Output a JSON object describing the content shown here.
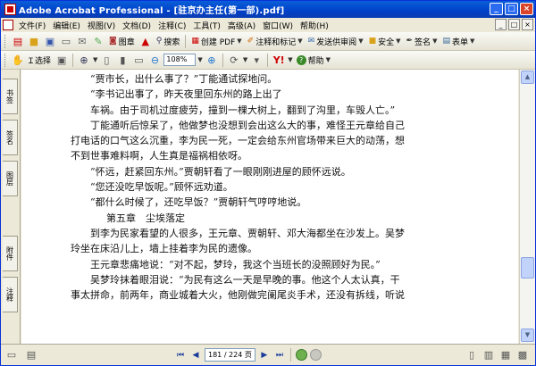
{
  "window": {
    "title": "Adobe Acrobat Professional - [驻京办主任(第一部).pdf]",
    "buttons": {
      "minimize": "_",
      "maximize": "□",
      "close": "×"
    }
  },
  "menu": {
    "items": [
      "文件(F)",
      "编辑(E)",
      "视图(V)",
      "文档(D)",
      "注释(C)",
      "工具(T)",
      "高级(A)",
      "窗口(W)",
      "帮助(H)"
    ]
  },
  "toolbar1": {
    "organizer": "图章",
    "search": "搜索",
    "create_pdf": "创建 PDF",
    "review": "注释和标记",
    "send": "发送供审阅",
    "secure": "安全",
    "sign": "签名",
    "forms": "表单"
  },
  "toolbar2": {
    "select": "选择",
    "zoom": "108%",
    "help": "帮助"
  },
  "side_tabs": [
    "书签",
    "签名",
    "图层",
    "附件",
    "注释"
  ],
  "document": {
    "lines": [
      "“贾市长，出什么事了？”丁能通试探地问。",
      "“李书记出事了，昨天夜里回东州的路上出了",
      "车祸。由于司机过度疲劳，撞到一棵大树上，翻到了沟里，车毁人亡。”",
      "丁能通听后惊呆了，他做梦也没想到会出这么大的事，难怪王元章给自己",
      "打电话的口气这么沉重，李为民一死，一定会给东州官场带来巨大的动荡，想",
      "不到世事难料啊，人生真是福祸相依呀。",
      "“怀远，赶紧回东州。”贾朝轩看了一眼刚刚进屋的顾怀远说。",
      "“您还没吃早饭呢。”顾怀远劝道。",
      "“都什么时候了，还吃早饭？”贾朝轩气哼哼地说。",
      "第五章　尘埃落定",
      "到李为民家看望的人很多，王元章、贾朝轩、邓大海都坐在沙发上。吴梦",
      "玲坐在床沿儿上，墙上挂着李为民的遗像。",
      "王元章悲痛地说：“对不起，梦玲，我这个当班长的没照顾好为民。”",
      "吴梦玲抹着眼泪说：“为民有这么一天是早晚的事。他这个人太认真，干",
      "事太拼命，前两年，商业城着大火，他刚做完阑尾炎手术，还没有拆线，听说"
    ]
  },
  "statusbar": {
    "page_indicator": "181 / 224 页"
  }
}
